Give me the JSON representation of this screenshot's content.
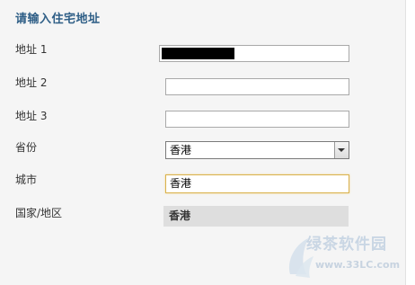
{
  "form": {
    "title": "请输入住宅地址",
    "address1": {
      "label": "地址 1",
      "value": ""
    },
    "address2": {
      "label": "地址 2",
      "value": ""
    },
    "address3": {
      "label": "地址 3",
      "value": ""
    },
    "province": {
      "label": "省份",
      "selected": "香港"
    },
    "city": {
      "label": "城市",
      "value": "香港"
    },
    "country": {
      "label": "国家/地区",
      "value": "香港"
    }
  },
  "watermark": {
    "main_text": "绿茶软件园",
    "url_text": "www.33LC.com"
  }
}
